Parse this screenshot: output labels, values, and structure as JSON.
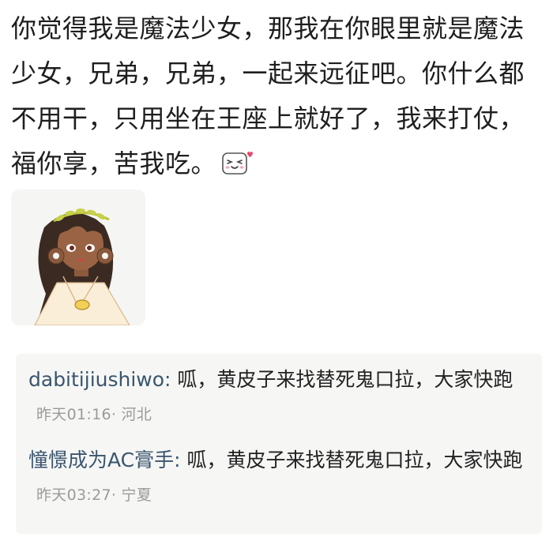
{
  "post": {
    "text": "你觉得我是魔法少女，那我在你眼里就是魔法少女，兄弟，兄弟，一起来远征吧。你什么都不用干，只用坐在王座上就好了，我来打仗，福你享，苦我吃。",
    "emoji_icon": "blushing-face-icon"
  },
  "sticker": {
    "icon": "laurel-wreath-girl-sticker"
  },
  "comments": [
    {
      "author": "dabitijiushiwo:",
      "text": " 呱，黄皮子来找替死鬼口拉，大家快跑",
      "time": "昨天01:16",
      "location": "· 河北"
    },
    {
      "author": "憧憬成为AC膏手:",
      "text": " 呱，黄皮子来找替死鬼口拉，大家快跑",
      "time": "昨天03:27",
      "location": "· 宁夏"
    }
  ]
}
